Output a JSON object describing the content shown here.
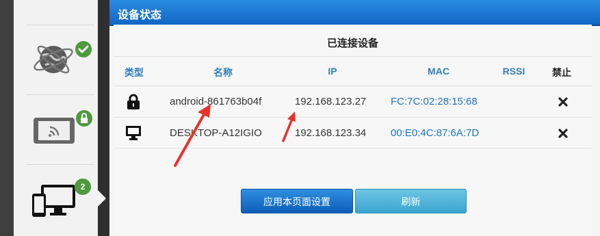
{
  "panel": {
    "title": "设备状态"
  },
  "section": {
    "title": "已连接设备"
  },
  "table": {
    "headers": {
      "type": "类型",
      "name": "名称",
      "ip": "IP",
      "mac": "MAC",
      "rssi": "RSSI",
      "block": "禁止"
    },
    "rows": [
      {
        "type_icon": "lock-icon",
        "name": "android-861763b04f",
        "ip": "192.168.123.27",
        "mac": "FC:7C:02:28:15:68",
        "rssi": ""
      },
      {
        "type_icon": "desktop-icon",
        "name": "DESKTOP-A12IGIO",
        "ip": "192.168.123.34",
        "mac": "00:E0:4C:87:6A:7D",
        "rssi": ""
      }
    ]
  },
  "buttons": {
    "apply": "应用本页面设置",
    "refresh": "刷新"
  },
  "sidebar": {
    "items": [
      {
        "icon": "globe-network-icon",
        "badge": "check"
      },
      {
        "icon": "tablet-wifi-icon",
        "badge": "lock"
      },
      {
        "icon": "devices-icon",
        "badge": "2"
      }
    ]
  },
  "colors": {
    "header": "#1a75d2",
    "accent": "#2f7fbf",
    "badge": "#4e9a3c",
    "annotation": "#e8332a"
  }
}
